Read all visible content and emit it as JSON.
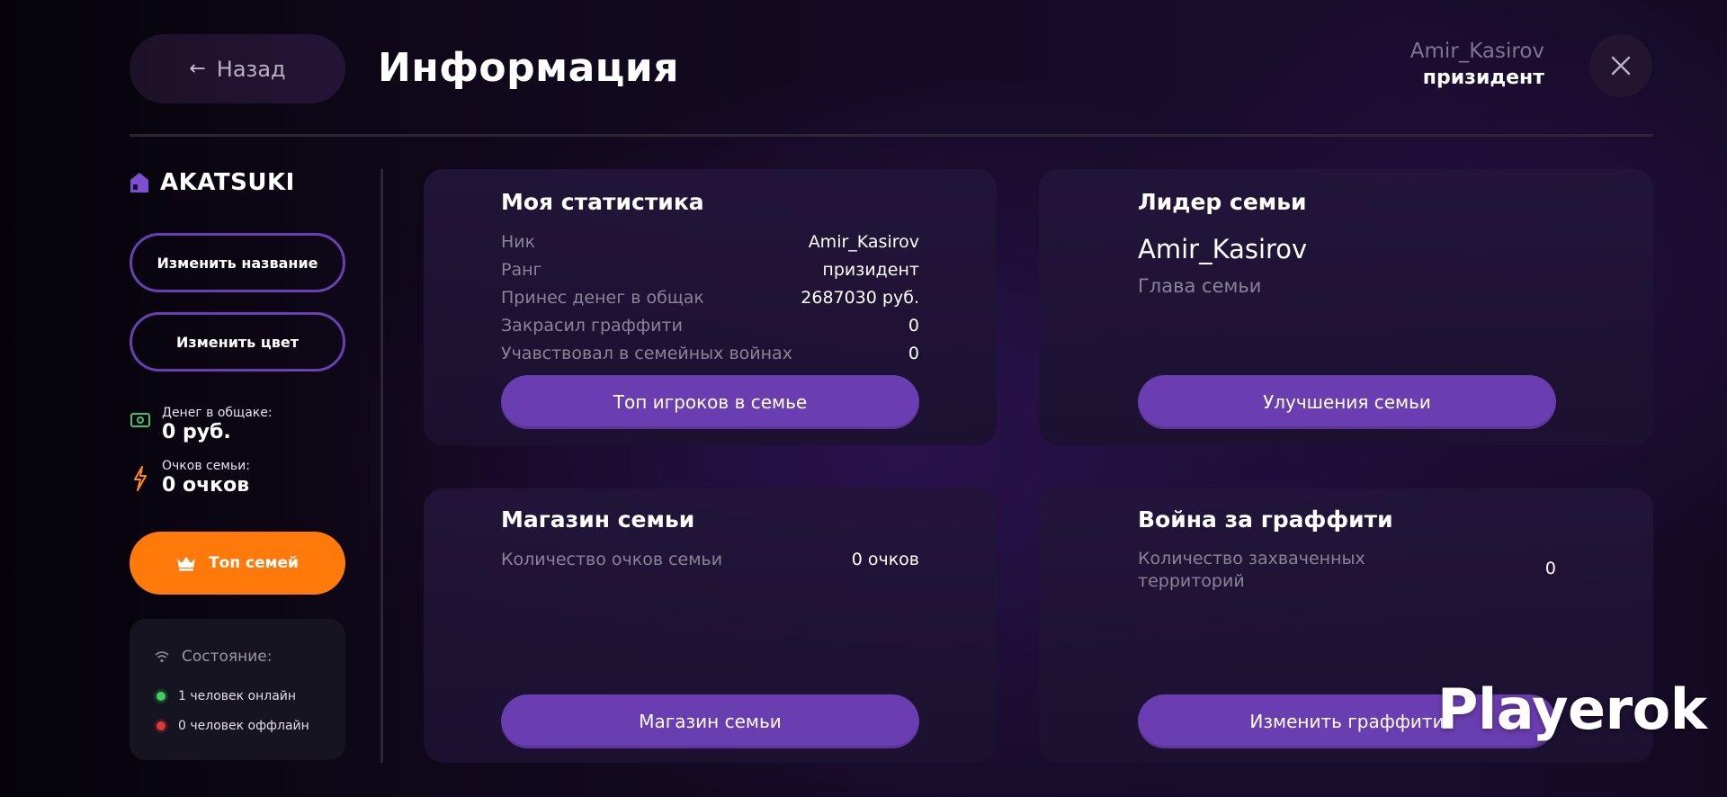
{
  "header": {
    "back_label": "Назад",
    "title": "Информация",
    "user_name": "Amir_Kasirov",
    "user_rank": "призидент"
  },
  "sidebar": {
    "family_name": "AKATSUKI",
    "rename_label": "Изменить название",
    "recolor_label": "Изменить цвет",
    "money_label": "Денег в общаке:",
    "money_value": "0 руб.",
    "points_label": "Очков семьи:",
    "points_value": "0 очков",
    "top_families_label": "Топ семей",
    "status": {
      "label": "Состояние:",
      "online": "1 человек онлайн",
      "offline": "0 человек оффлайн"
    }
  },
  "my_stats": {
    "title": "Моя статистика",
    "rows": [
      {
        "key": "Ник",
        "value": "Amir_Kasirov"
      },
      {
        "key": "Ранг",
        "value": "призидент"
      },
      {
        "key": "Принес денег в общак",
        "value": "2687030 руб."
      },
      {
        "key": "Закрасил граффити",
        "value": "0"
      },
      {
        "key": "Учавствовал в семейных войнах",
        "value": "0"
      }
    ],
    "button_label": "Топ игроков в семье"
  },
  "leader": {
    "title": "Лидер семьи",
    "name": "Amir_Kasirov",
    "role": "Глава семьи",
    "button_label": "Улучшения семьи"
  },
  "shop": {
    "title": "Магазин семьи",
    "points_label": "Количество очков семьи",
    "points_value": "0 очков",
    "button_label": "Магазин семьи"
  },
  "graffiti_war": {
    "title": "Война за граффити",
    "territories_label": "Количество захваченных территорий",
    "territories_value": "0",
    "button_label": "Изменить граффити"
  },
  "watermark": "Playerok",
  "colors": {
    "accent_purple": "#6a3db0",
    "accent_orange": "#ff7a0a",
    "online": "#3ed160",
    "offline": "#e03838"
  }
}
